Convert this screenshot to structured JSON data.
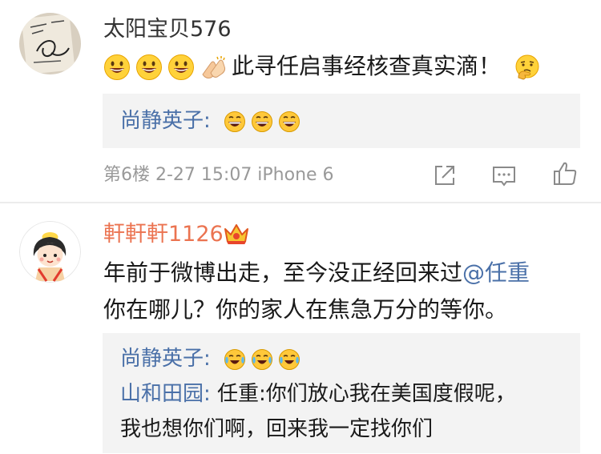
{
  "comments": [
    {
      "username": "太阳宝贝576",
      "body": "此寻任启事经核查真实滴！",
      "body_emojis": [
        "grin-emoji",
        "grin-emoji",
        "grin-emoji",
        "clap-hands-emoji"
      ],
      "body_trailing_emoji": "thinking-emoji",
      "replies": [
        {
          "name": "尚静英子:",
          "text": "",
          "emojis": [
            "laugh-emoji",
            "laugh-emoji",
            "laugh-emoji"
          ]
        }
      ],
      "meta": "第6楼 2-27 15:07 iPhone 6",
      "actions": [
        "share-icon",
        "comment-icon",
        "like-icon"
      ]
    },
    {
      "username": "軒軒軒1126",
      "badge": "crown-badge-icon",
      "body_line1_prefix": "年前于微博出走，至今没正经回来过",
      "body_line1_mention": "@任重",
      "body_line2": "你在哪儿？你的家人在焦急万分的等你。",
      "replies": [
        {
          "name": "尚静英子:",
          "text": "",
          "emojis": [
            "cry-laugh-emoji",
            "cry-laugh-emoji",
            "cry-laugh-emoji"
          ]
        },
        {
          "name": "山和田园:",
          "text": " 任重:你们放心我在美国度假呢，",
          "emojis": []
        }
      ],
      "reply_continuation": "我也想你们啊，回来我一定找你们"
    }
  ],
  "colors": {
    "username_vip": "#eb7350",
    "link": "#4a70a8",
    "meta": "#999999",
    "reply_bg": "#f3f3f3"
  }
}
